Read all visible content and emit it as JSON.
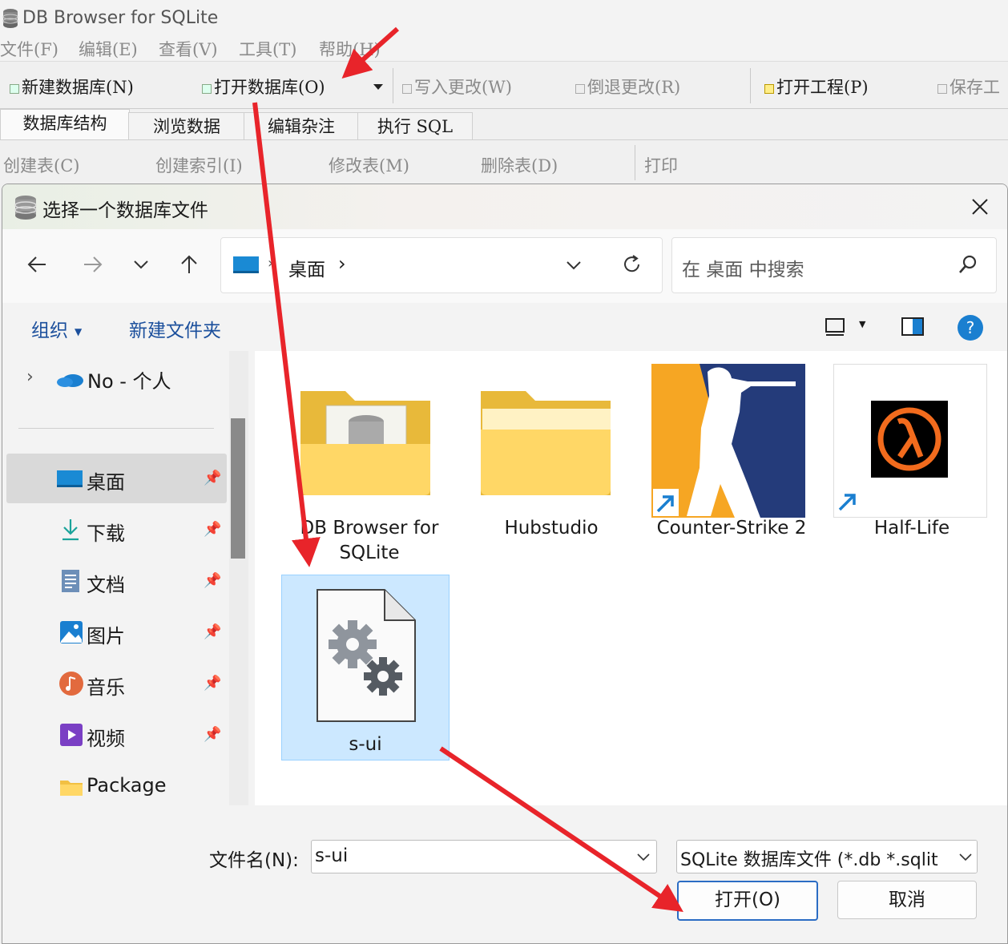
{
  "app": {
    "title": "DB Browser for SQLite",
    "menu": [
      "文件(F)",
      "编辑(E)",
      "查看(V)",
      "工具(T)",
      "帮助(H)"
    ],
    "toolbar": {
      "new_db": "新建数据库(N)",
      "open_db": "打开数据库(O)",
      "write_changes": "写入更改(W)",
      "revert_changes": "倒退更改(R)",
      "open_project": "打开工程(P)",
      "save_project": "保存工"
    },
    "tabs": [
      "数据库结构",
      "浏览数据",
      "编辑杂注",
      "执行 SQL"
    ],
    "sub_toolbar": {
      "create_table": "创建表(C)",
      "create_index": "创建索引(I)",
      "modify_table": "修改表(M)",
      "delete_table": "删除表(D)",
      "print": "打印"
    }
  },
  "dialog": {
    "title": "选择一个数据库文件",
    "breadcrumb": "桌面",
    "search_placeholder": "在 桌面 中搜索",
    "organize": "组织",
    "new_folder": "新建文件夹",
    "sidebar": {
      "onedrive": "No - 个人",
      "items": [
        {
          "label": "桌面",
          "icon": "desktop-icon",
          "pinned": true,
          "selected": true
        },
        {
          "label": "下载",
          "icon": "download-icon",
          "pinned": true
        },
        {
          "label": "文档",
          "icon": "document-icon",
          "pinned": true
        },
        {
          "label": "图片",
          "icon": "picture-icon",
          "pinned": true
        },
        {
          "label": "音乐",
          "icon": "music-icon",
          "pinned": true
        },
        {
          "label": "视频",
          "icon": "video-icon",
          "pinned": true
        },
        {
          "label": "Package",
          "icon": "folder-icon",
          "pinned": false
        }
      ]
    },
    "files": [
      {
        "name": "DB Browser for SQLite",
        "type": "folder"
      },
      {
        "name": "Hubstudio",
        "type": "folder"
      },
      {
        "name": "Counter-Strike 2",
        "type": "shortcut"
      },
      {
        "name": "Half-Life",
        "type": "shortcut"
      },
      {
        "name": "s-ui",
        "type": "file",
        "selected": true
      }
    ],
    "filename_label": "文件名(N):",
    "filename_value": "s-ui",
    "filter": "SQLite 数据库文件 (*.db *.sqlit",
    "open_button": "打开(O)",
    "cancel_button": "取消"
  },
  "colors": {
    "annotation_arrow": "#e8242a",
    "selection": "#cce8ff",
    "accent": "#0067c0"
  }
}
